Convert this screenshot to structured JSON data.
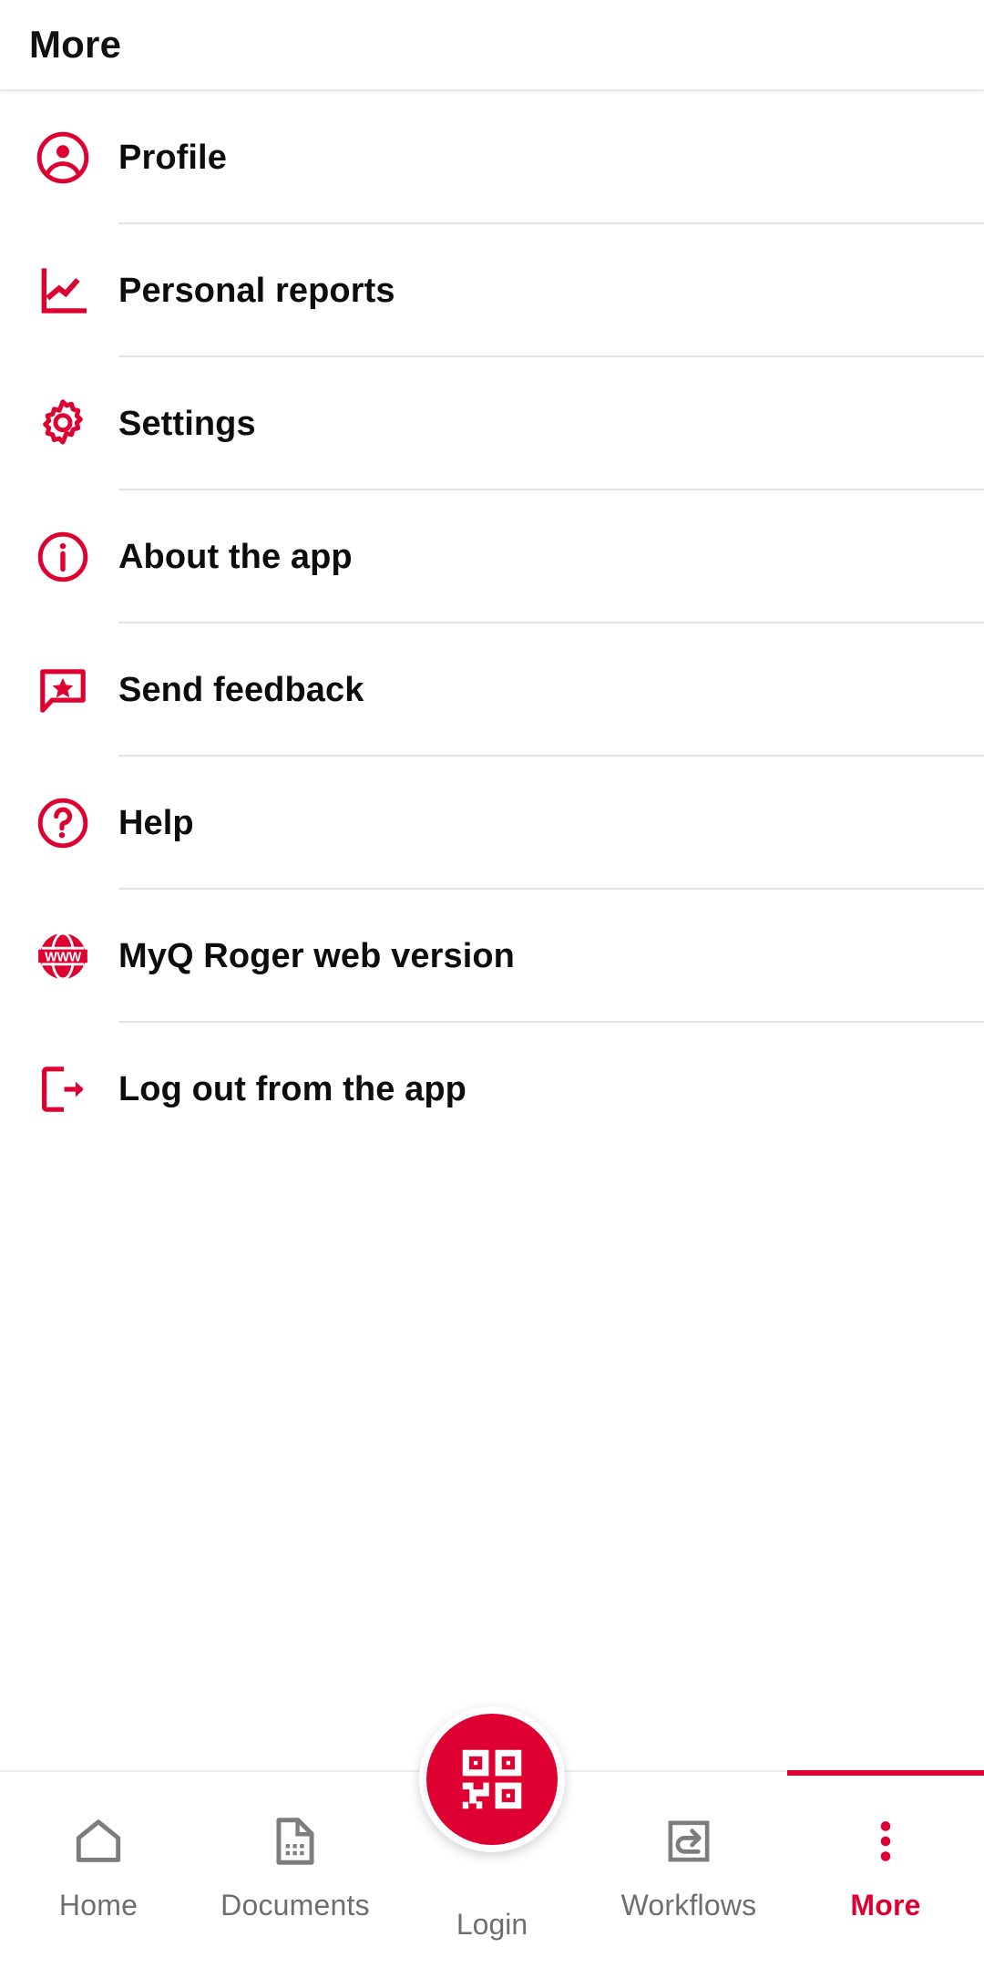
{
  "header": {
    "title": "More"
  },
  "theme": {
    "accent": "#dd0031",
    "text_primary": "#0d0d0d",
    "text_muted": "#6e6e6e",
    "divider": "#e2e2e2",
    "background": "#ffffff"
  },
  "menu": {
    "items": [
      {
        "label": "Profile",
        "icon": "account-circle-icon"
      },
      {
        "label": "Personal reports",
        "icon": "line-chart-icon"
      },
      {
        "label": "Settings",
        "icon": "gear-icon"
      },
      {
        "label": "About the app",
        "icon": "info-circle-icon"
      },
      {
        "label": "Send feedback",
        "icon": "feedback-star-bubble-icon"
      },
      {
        "label": "Help",
        "icon": "question-circle-icon"
      },
      {
        "label": "MyQ Roger web version",
        "icon": "www-globe-icon"
      },
      {
        "label": "Log out from the app",
        "icon": "logout-icon"
      }
    ]
  },
  "bottom_nav": {
    "items": [
      {
        "label": "Home",
        "icon": "home-icon",
        "active": false
      },
      {
        "label": "Documents",
        "icon": "document-icon",
        "active": false
      },
      {
        "label": "Login",
        "icon": "qr-code-icon",
        "active": false
      },
      {
        "label": "Workflows",
        "icon": "workflow-arrow-icon",
        "active": false
      },
      {
        "label": "More",
        "icon": "kebab-menu-icon",
        "active": true
      }
    ]
  }
}
